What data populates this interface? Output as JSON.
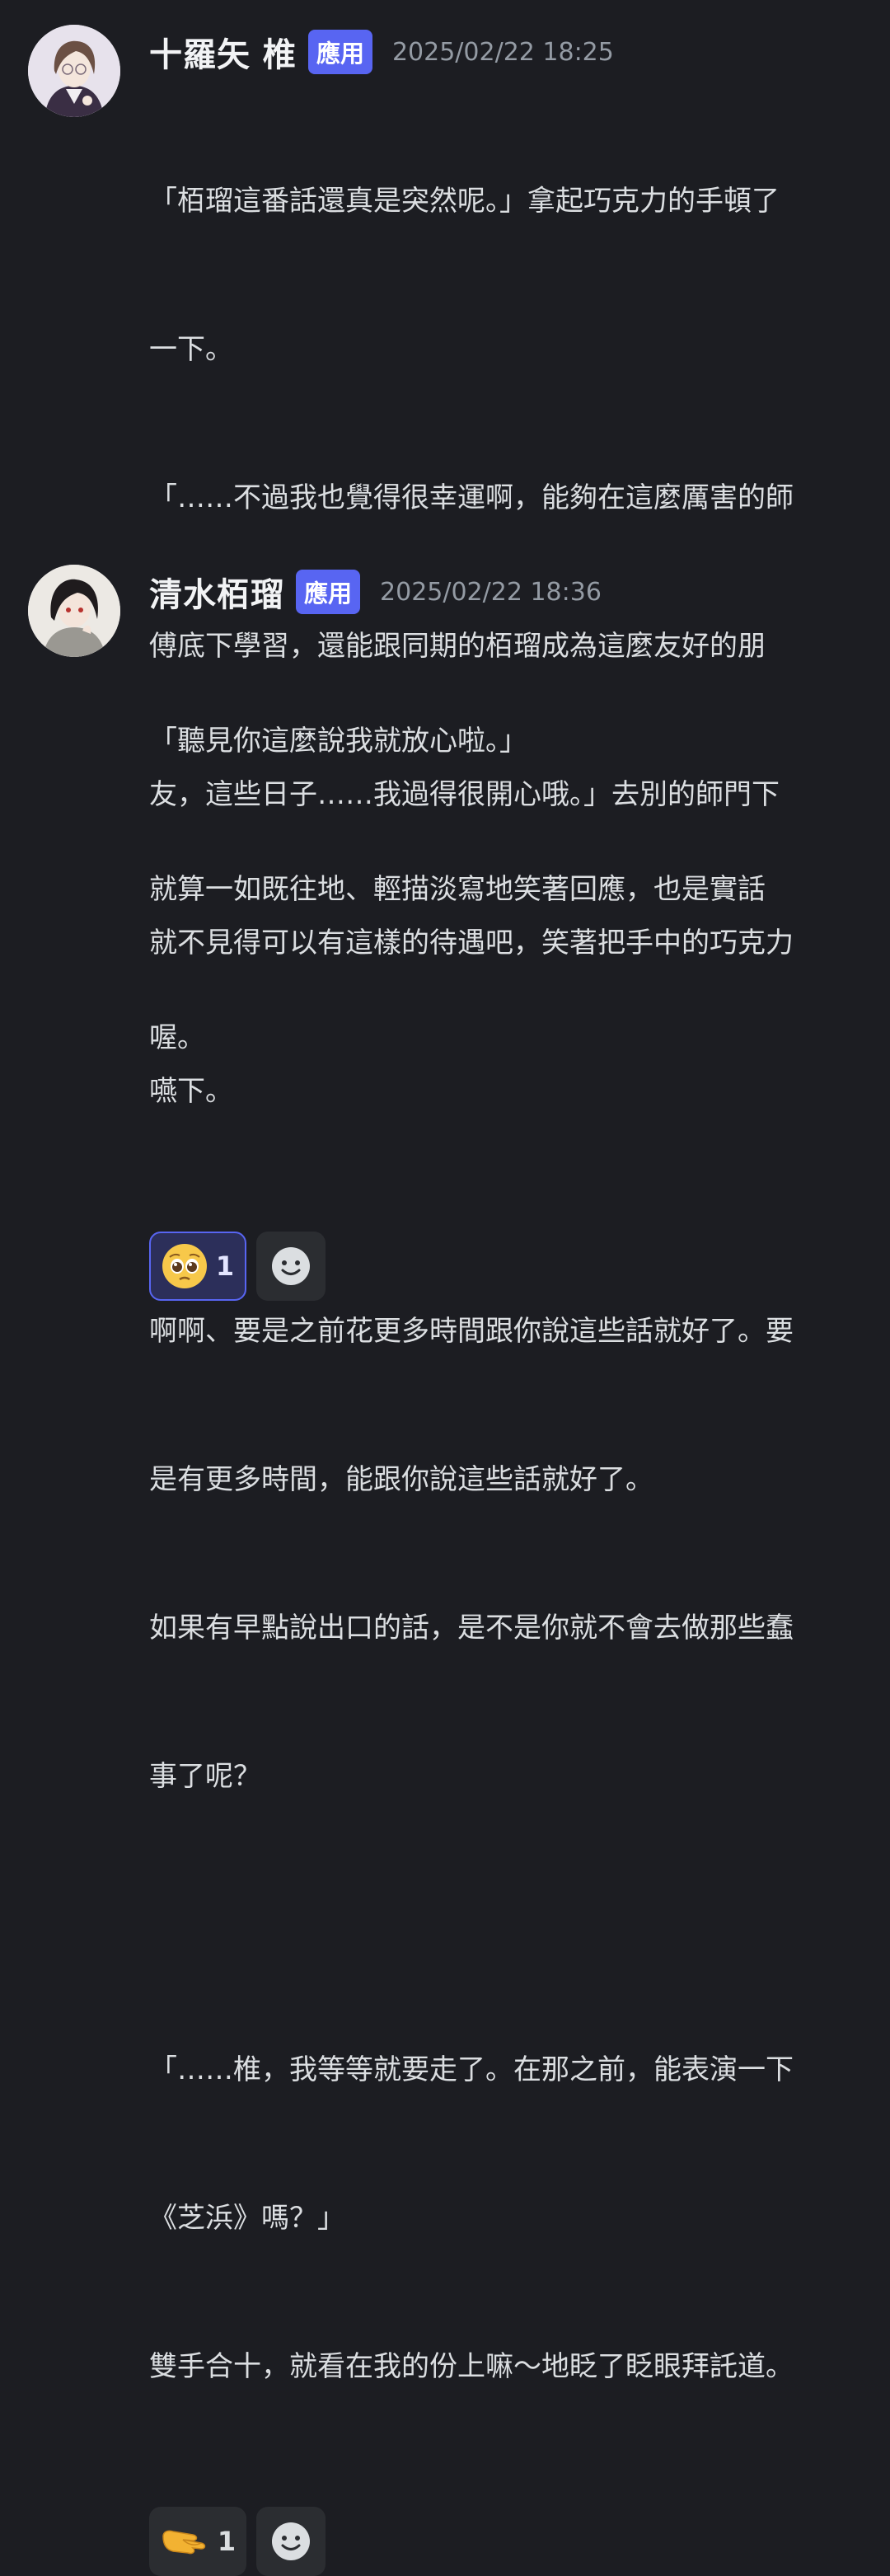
{
  "messages": [
    {
      "author": "十羅矢 椎",
      "tag": "應用",
      "timestamp": "2025/02/22 18:25",
      "lines": [
        "「栢瑠這番話還真是突然呢。」拿起巧克力的手頓了",
        "一下。",
        "「……不過我也覺得很幸運啊，能夠在這麼厲害的師",
        "傅底下學習，還能跟同期的栢瑠成為這麼友好的朋",
        "友，這些日子……我過得很開心哦。」去別的師門下",
        "就不見得可以有這樣的待遇吧，笑著把手中的巧克力",
        "嚥下。"
      ],
      "reaction": {
        "emoji": "pleading-face",
        "glyph": "🥺",
        "count": "1"
      },
      "avatar_icon": "avatar-glasses-character"
    },
    {
      "author": "清水栢瑠",
      "tag": "應用",
      "timestamp": "2025/02/22 18:36",
      "lines": [
        "「聽見你這麼說我就放心啦。」",
        "就算一如既往地、輕描淡寫地笑著回應，也是實話",
        "喔。",
        "",
        "啊啊、要是之前花更多時間跟你說這些話就好了。要",
        "是有更多時間，能跟你說這些話就好了。",
        "如果有早點說出口的話，是不是你就不會去做那些蠢",
        "事了呢？",
        "",
        "「……椎，我等等就要走了。在那之前，能表演一下",
        "《芝浜》嗎？」",
        "雙手合十，就看在我的份上嘛～地眨了眨眼拜託道。"
      ],
      "reaction": {
        "emoji": "pinching-hand",
        "glyph": "🤏",
        "count": "1"
      },
      "avatar_icon": "avatar-dark-hair-character"
    }
  ],
  "add_reaction_icon": "smiley-add-reaction-icon",
  "colors": {
    "background": "#1c1d22",
    "tag": "#5865f2",
    "timestamp": "#949ba4",
    "reaction_bg": "#2b2d31",
    "reaction_active_border": "#5865f2"
  }
}
